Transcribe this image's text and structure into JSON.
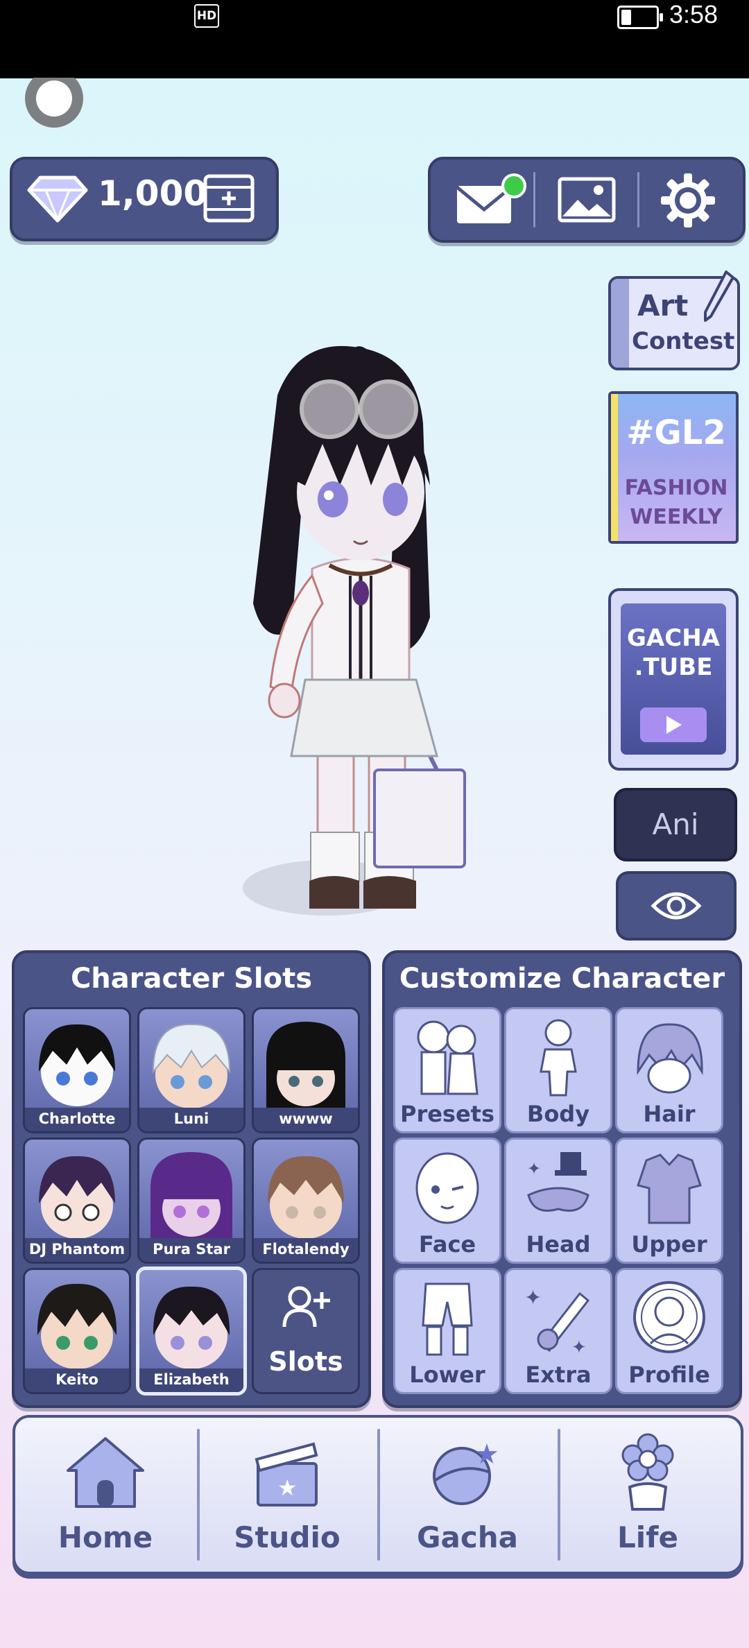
{
  "status_bar": {
    "hd": "HD",
    "time": "3:58"
  },
  "currency": {
    "amount": "1,000"
  },
  "side": {
    "art_contest": [
      "Art",
      "Contest"
    ],
    "fashion": [
      "#GL2",
      "FASHION",
      "WEEKLY"
    ],
    "gacha_tube": [
      "GACHA",
      ".TUBE"
    ],
    "ani": "Ani"
  },
  "slots_panel": {
    "title": "Character Slots",
    "slots": [
      "Charlotte",
      "Luni",
      "wwww",
      "DJ Phantom",
      "Pura Star",
      "Flotalendy",
      "Keito",
      "Elizabeth"
    ],
    "add_label": "Slots"
  },
  "customize_panel": {
    "title": "Customize Character",
    "items": [
      "Presets",
      "Body",
      "Hair",
      "Face",
      "Head",
      "Upper",
      "Lower",
      "Extra",
      "Profile"
    ]
  },
  "nav": {
    "items": [
      "Home",
      "Studio",
      "Gacha",
      "Life"
    ]
  },
  "colors": {
    "panel": "#4b5487",
    "panel_border": "#353c67",
    "tile_light": "#c3c9f3",
    "online_dot": "#3ecb4a"
  }
}
